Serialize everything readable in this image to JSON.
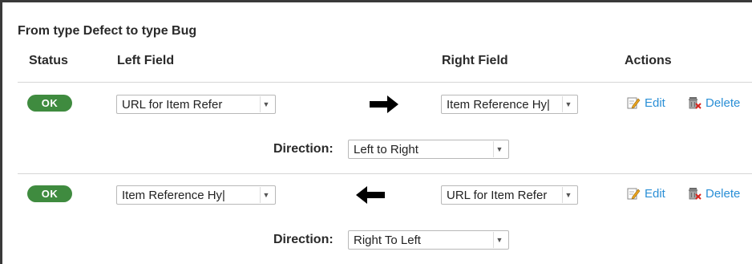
{
  "panel": {
    "title": "From type Defect to type Bug"
  },
  "headers": {
    "status": "Status",
    "left_field": "Left Field",
    "right_field": "Right Field",
    "actions": "Actions"
  },
  "mappings": [
    {
      "status": "OK",
      "left_field": "URL for Item Refer",
      "arrow": "right-arrow-icon",
      "right_field": "Item Reference Hy|",
      "edit_label": "Edit",
      "delete_label": "Delete",
      "direction_label": "Direction:",
      "direction_value": "Left to Right"
    },
    {
      "status": "OK",
      "left_field": "Item Reference Hy|",
      "arrow": "left-arrow-icon",
      "right_field": "URL for Item Refer",
      "edit_label": "Edit",
      "delete_label": "Delete",
      "direction_label": "Direction:",
      "direction_value": "Right To Left"
    }
  ],
  "colors": {
    "status_ok": "#3f8b3f",
    "link": "#2a8fd6",
    "border": "#3a3a3a"
  }
}
